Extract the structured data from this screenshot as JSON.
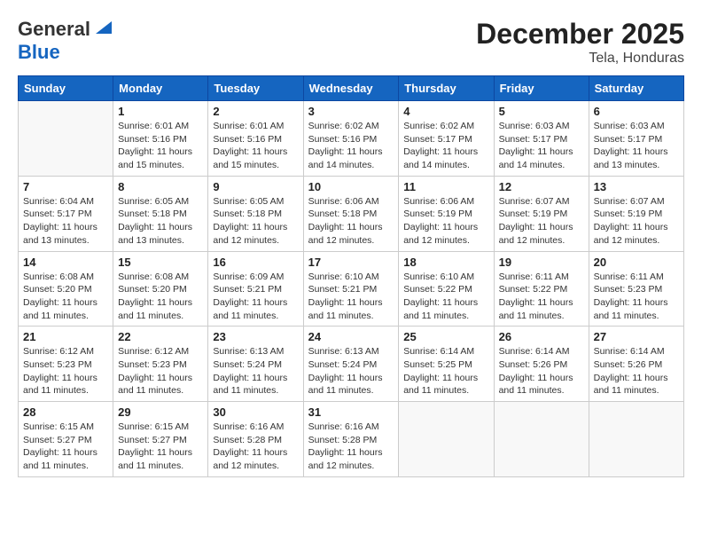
{
  "header": {
    "logo_line1": "General",
    "logo_line2": "Blue",
    "month_year": "December 2025",
    "location": "Tela, Honduras"
  },
  "days_of_week": [
    "Sunday",
    "Monday",
    "Tuesday",
    "Wednesday",
    "Thursday",
    "Friday",
    "Saturday"
  ],
  "weeks": [
    [
      {
        "day": "",
        "content": ""
      },
      {
        "day": "1",
        "content": "Sunrise: 6:01 AM\nSunset: 5:16 PM\nDaylight: 11 hours\nand 15 minutes."
      },
      {
        "day": "2",
        "content": "Sunrise: 6:01 AM\nSunset: 5:16 PM\nDaylight: 11 hours\nand 15 minutes."
      },
      {
        "day": "3",
        "content": "Sunrise: 6:02 AM\nSunset: 5:16 PM\nDaylight: 11 hours\nand 14 minutes."
      },
      {
        "day": "4",
        "content": "Sunrise: 6:02 AM\nSunset: 5:17 PM\nDaylight: 11 hours\nand 14 minutes."
      },
      {
        "day": "5",
        "content": "Sunrise: 6:03 AM\nSunset: 5:17 PM\nDaylight: 11 hours\nand 14 minutes."
      },
      {
        "day": "6",
        "content": "Sunrise: 6:03 AM\nSunset: 5:17 PM\nDaylight: 11 hours\nand 13 minutes."
      }
    ],
    [
      {
        "day": "7",
        "content": "Sunrise: 6:04 AM\nSunset: 5:17 PM\nDaylight: 11 hours\nand 13 minutes."
      },
      {
        "day": "8",
        "content": "Sunrise: 6:05 AM\nSunset: 5:18 PM\nDaylight: 11 hours\nand 13 minutes."
      },
      {
        "day": "9",
        "content": "Sunrise: 6:05 AM\nSunset: 5:18 PM\nDaylight: 11 hours\nand 12 minutes."
      },
      {
        "day": "10",
        "content": "Sunrise: 6:06 AM\nSunset: 5:18 PM\nDaylight: 11 hours\nand 12 minutes."
      },
      {
        "day": "11",
        "content": "Sunrise: 6:06 AM\nSunset: 5:19 PM\nDaylight: 11 hours\nand 12 minutes."
      },
      {
        "day": "12",
        "content": "Sunrise: 6:07 AM\nSunset: 5:19 PM\nDaylight: 11 hours\nand 12 minutes."
      },
      {
        "day": "13",
        "content": "Sunrise: 6:07 AM\nSunset: 5:19 PM\nDaylight: 11 hours\nand 12 minutes."
      }
    ],
    [
      {
        "day": "14",
        "content": "Sunrise: 6:08 AM\nSunset: 5:20 PM\nDaylight: 11 hours\nand 11 minutes."
      },
      {
        "day": "15",
        "content": "Sunrise: 6:08 AM\nSunset: 5:20 PM\nDaylight: 11 hours\nand 11 minutes."
      },
      {
        "day": "16",
        "content": "Sunrise: 6:09 AM\nSunset: 5:21 PM\nDaylight: 11 hours\nand 11 minutes."
      },
      {
        "day": "17",
        "content": "Sunrise: 6:10 AM\nSunset: 5:21 PM\nDaylight: 11 hours\nand 11 minutes."
      },
      {
        "day": "18",
        "content": "Sunrise: 6:10 AM\nSunset: 5:22 PM\nDaylight: 11 hours\nand 11 minutes."
      },
      {
        "day": "19",
        "content": "Sunrise: 6:11 AM\nSunset: 5:22 PM\nDaylight: 11 hours\nand 11 minutes."
      },
      {
        "day": "20",
        "content": "Sunrise: 6:11 AM\nSunset: 5:23 PM\nDaylight: 11 hours\nand 11 minutes."
      }
    ],
    [
      {
        "day": "21",
        "content": "Sunrise: 6:12 AM\nSunset: 5:23 PM\nDaylight: 11 hours\nand 11 minutes."
      },
      {
        "day": "22",
        "content": "Sunrise: 6:12 AM\nSunset: 5:23 PM\nDaylight: 11 hours\nand 11 minutes."
      },
      {
        "day": "23",
        "content": "Sunrise: 6:13 AM\nSunset: 5:24 PM\nDaylight: 11 hours\nand 11 minutes."
      },
      {
        "day": "24",
        "content": "Sunrise: 6:13 AM\nSunset: 5:24 PM\nDaylight: 11 hours\nand 11 minutes."
      },
      {
        "day": "25",
        "content": "Sunrise: 6:14 AM\nSunset: 5:25 PM\nDaylight: 11 hours\nand 11 minutes."
      },
      {
        "day": "26",
        "content": "Sunrise: 6:14 AM\nSunset: 5:26 PM\nDaylight: 11 hours\nand 11 minutes."
      },
      {
        "day": "27",
        "content": "Sunrise: 6:14 AM\nSunset: 5:26 PM\nDaylight: 11 hours\nand 11 minutes."
      }
    ],
    [
      {
        "day": "28",
        "content": "Sunrise: 6:15 AM\nSunset: 5:27 PM\nDaylight: 11 hours\nand 11 minutes."
      },
      {
        "day": "29",
        "content": "Sunrise: 6:15 AM\nSunset: 5:27 PM\nDaylight: 11 hours\nand 11 minutes."
      },
      {
        "day": "30",
        "content": "Sunrise: 6:16 AM\nSunset: 5:28 PM\nDaylight: 11 hours\nand 12 minutes."
      },
      {
        "day": "31",
        "content": "Sunrise: 6:16 AM\nSunset: 5:28 PM\nDaylight: 11 hours\nand 12 minutes."
      },
      {
        "day": "",
        "content": ""
      },
      {
        "day": "",
        "content": ""
      },
      {
        "day": "",
        "content": ""
      }
    ]
  ]
}
